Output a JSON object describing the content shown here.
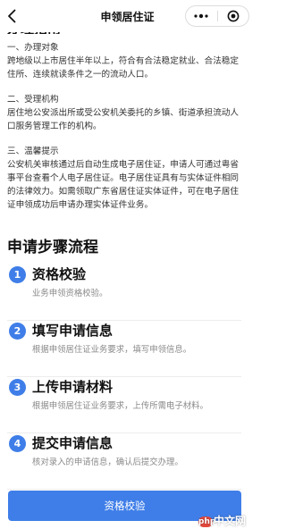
{
  "nav": {
    "title": "申领居住证"
  },
  "section_head": "办理指南",
  "guide": [
    {
      "heading": "一、办理对象",
      "body": "跨地级以上市居住半年以上，符合有合法稳定就业、合法稳定住所、连续就读条件之一的流动人口。"
    },
    {
      "heading": "二、受理机构",
      "body": "居住地公安派出所或受公安机关委托的乡镇、街道承担流动人口服务管理工作的机构。"
    },
    {
      "heading": "三、温馨提示",
      "body": "公安机关审核通过后自动生成电子居住证，申请人可通过粤省事平台查看个人电子居住证。电子居住证具有与实体证件相同的法律效力。如需领取广东省居住证实体证件，可在电子居住证申领成功后申请办理实体证件业务。"
    }
  ],
  "steps_title": "申请步骤流程",
  "steps": [
    {
      "num": "1",
      "name": "资格校验",
      "desc": "业务申领资格校验。"
    },
    {
      "num": "2",
      "name": "填写申请信息",
      "desc": "根据申领居住证业务要求，填写申领信息。"
    },
    {
      "num": "3",
      "name": "上传申请材料",
      "desc": "根据申领居住证业务要求，上传所需电子材料。"
    },
    {
      "num": "4",
      "name": "提交申请信息",
      "desc": "核对录入的申请信息，确认后提交办理。"
    }
  ],
  "cta_label": "资格校验",
  "watermark": {
    "logo": "php",
    "text": "中文网"
  },
  "colors": {
    "accent": "#3f7ee8"
  }
}
